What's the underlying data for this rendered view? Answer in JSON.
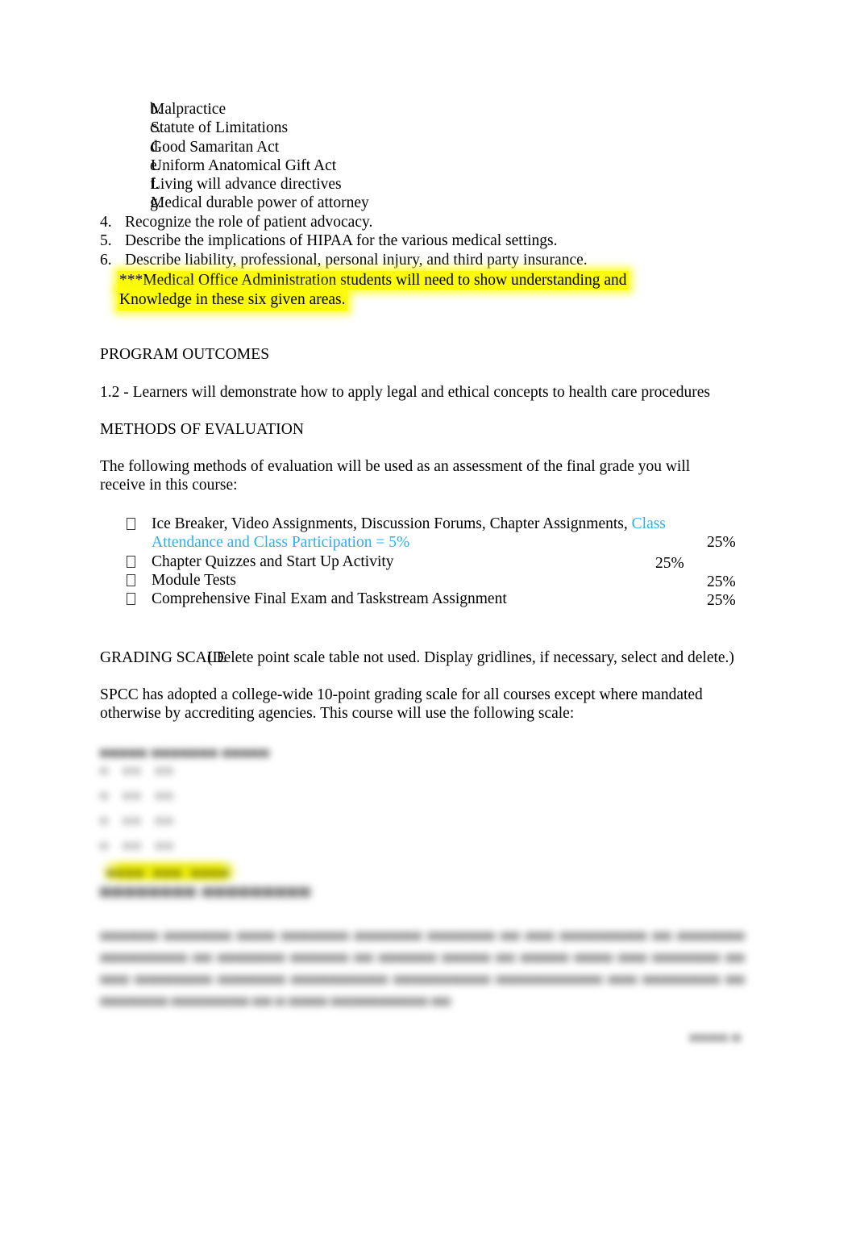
{
  "document": {
    "type": "course-syllabus-page",
    "page_background": "#ffffff",
    "body_text_color": "#000000",
    "accent_cyan": "#29b2e8",
    "highlight_yellow": "#fbfb0a"
  },
  "objectives": {
    "sub_items": [
      {
        "marker": "b.",
        "text": "Malpractice"
      },
      {
        "marker": "c.",
        "text": "Statute of Limitations"
      },
      {
        "marker": "d.",
        "text": "Good Samaritan Act"
      },
      {
        "marker": "e.",
        "text": "Uniform Anatomical Gift Act"
      },
      {
        "marker": "f.",
        "text": "Living will advance directives"
      },
      {
        "marker": "g.",
        "text": "Medical durable power of attorney"
      }
    ],
    "numbered_items": [
      {
        "marker": "4.",
        "text": "Recognize the role of patient advocacy."
      },
      {
        "marker": "5.",
        "text": "Describe the implications of HIPAA for the various medical settings."
      },
      {
        "marker": "6.",
        "text": "Describe liability, professional, personal injury, and third party insurance."
      }
    ],
    "highlighted_note_line1": "***Medical Office Administration students will need to show understanding and",
    "highlighted_note_line2": "Knowledge in these six given areas."
  },
  "program_outcomes": {
    "heading": "PROGRAM OUTCOMES",
    "body": "1.2 - Learners will demonstrate how to apply legal and ethical concepts to health care procedures"
  },
  "methods_of_evaluation": {
    "heading": "METHODS OF EVALUATION",
    "intro_line1": "The following methods of evaluation will be used as an assessment of the final grade you will",
    "intro_line2": "receive in this course:",
    "items": [
      {
        "bullet": "box-glyph",
        "text_black": "Ice Breaker, Video Assignments, Discussion Forums, Chapter Assignments,  ",
        "text_cyan_line1": "Class",
        "text_cyan_line2": "Attendance and Class Participation = 5%",
        "percent": "25%"
      },
      {
        "bullet": "box-glyph",
        "text_black": "Chapter Quizzes and Start Up Activity",
        "percent": "25%"
      },
      {
        "bullet": "box-glyph",
        "text_black": "Module Tests",
        "percent": "25%"
      },
      {
        "bullet": "box-glyph",
        "text_black": "Comprehensive Final Exam and Taskstream Assignment",
        "percent": "25%"
      }
    ]
  },
  "grading_scale": {
    "heading": "GRADING SCALE",
    "editor_note": "(Delete point scale table not used. Display gridlines, if necessary, select and delete.)",
    "body_line1": "SPCC has adopted a college-wide 10-point grading scale for all courses except where mandated",
    "body_line2": "otherwise by accrediting agencies. This course will use the following scale:",
    "table_redacted": {
      "state": "blurred-unreadable",
      "header_placeholder": "▄▄▄▄▄ ▄▄▄▄▄▄▄ ▄▄▄▄▄",
      "rows_placeholder": [
        "▄   ▄▄   ▄▄",
        "▄   ▄▄   ▄▄",
        "▄   ▄▄   ▄▄",
        "▄   ▄▄   ▄▄"
      ],
      "highlighted_row_placeholder": "▄▄▄▄  ▄▄▄  ▄▄▄▄"
    }
  },
  "academic_integrity": {
    "heading_redacted": "▄▄▄▄▄▄▄▄ ▄▄▄▄▄▄▄▄▄",
    "paragraph_redacted": "▄▄▄▄▄▄ ▄▄▄▄▄▄▄ ▄▄▄▄ ▄▄▄▄▄▄▄ ▄▄▄▄▄▄▄ ▄▄▄▄▄▄▄ ▄▄ ▄▄▄ ▄▄▄▄▄▄▄▄▄ ▄▄ ▄▄▄▄▄▄▄ ▄▄▄▄▄▄▄▄▄ ▄▄ ▄▄▄▄▄▄▄ ▄▄▄▄▄▄ ▄▄ ▄▄▄▄▄▄ ▄▄▄▄▄ ▄▄ ▄▄▄▄▄ ▄▄▄▄ ▄▄▄ ▄▄▄▄▄▄▄ ▄▄ ▄▄▄ ▄▄▄▄▄▄▄▄ ▄▄▄▄▄▄▄ ▄▄▄▄▄▄▄▄▄▄ ▄▄▄▄▄▄▄▄▄▄ ▄▄▄▄▄▄▄▄▄▄▄ ▄▄▄ ▄▄▄▄▄▄▄▄ ▄▄ ▄▄▄▄▄▄▄ ▄▄▄▄▄▄▄▄ ▄▄ ▄ ▄▄▄▄ ▄▄▄▄▄▄▄▄▄▄ ▄▄"
  },
  "footer": {
    "page_label_redacted": "▄▄▄▄ ▄"
  }
}
